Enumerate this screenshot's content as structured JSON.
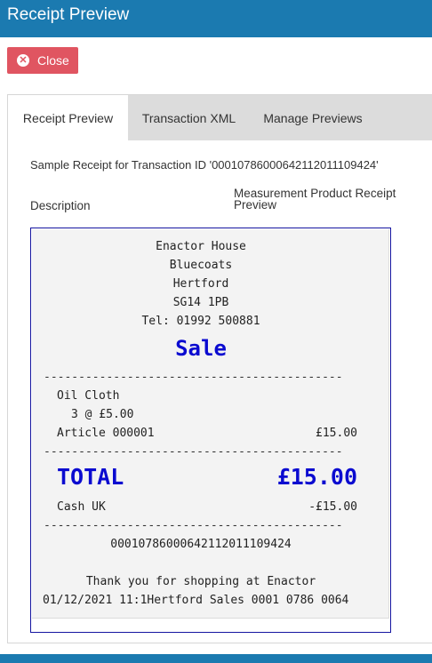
{
  "window": {
    "title": "Receipt Preview"
  },
  "toolbar": {
    "close_label": "Close",
    "close_icon": "close-circle-icon"
  },
  "tabs": [
    {
      "label": "Receipt Preview",
      "active": true
    },
    {
      "label": "Transaction XML",
      "active": false
    },
    {
      "label": "Manage Previews",
      "active": false
    }
  ],
  "content": {
    "sample_text": "Sample Receipt for Transaction ID '000107860006421120111094​24'",
    "col_description": "Description",
    "col_measurement": "Measurement Product Receipt Preview"
  },
  "receipt": {
    "address": [
      "Enactor House",
      "Bluecoats",
      "Hertford",
      "SG14 1PB",
      "Tel: 01992 500881"
    ],
    "heading": "Sale",
    "divider": "-------------------------------------------",
    "item_name": "Oil Cloth",
    "item_qty": "3 @ £5.00",
    "article_label": "Article 000001",
    "article_amount": "£15.00",
    "total_label": "TOTAL",
    "total_amount": "£15.00",
    "tender_label": "Cash UK",
    "tender_amount": "-£15.00",
    "transaction_id": "000107860006421120111094​24",
    "thanks": "Thank you for shopping at Enactor",
    "footer": "01/12/2021 11:1Hertford Sales 0001 0786 0064"
  },
  "colors": {
    "brand": "#1b7ab0",
    "close": "#e05561",
    "receipt_accent": "#0b0bd0"
  }
}
